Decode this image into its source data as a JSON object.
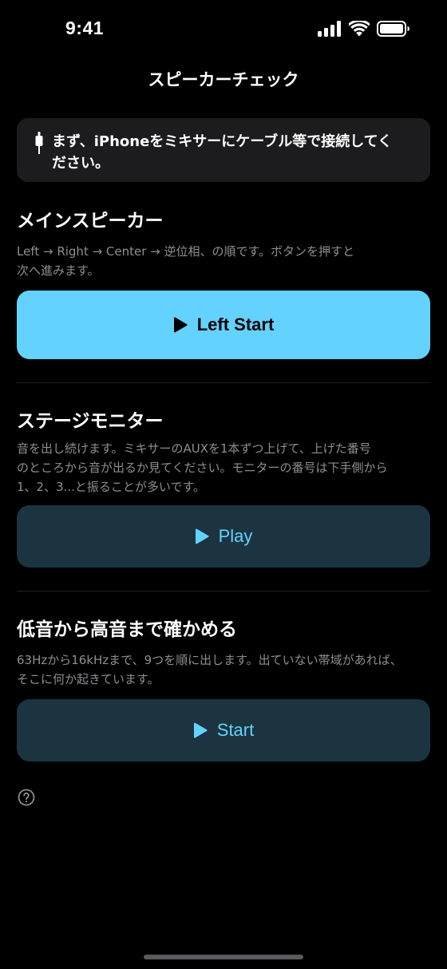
{
  "status_bar": {
    "time": "9:41"
  },
  "nav": {
    "title": "スピーカーチェック"
  },
  "info_banner": {
    "icon": "cable-icon",
    "text": "まず、iPhoneをミキサーにケーブル等で接続してください。"
  },
  "main_speaker": {
    "title": "メインスピーカー",
    "description_lines": [
      "Left → Right → Center → 逆位相、の順です。ボタンを押すと",
      "次へ進みます。"
    ],
    "button_label": "Left Start",
    "button_icon": "play-icon"
  },
  "stage_monitor": {
    "title": "ステージモニター",
    "description_lines": [
      "音を出し続けます。ミキサーのAUXを1本ずつ上げて、上げた番号",
      "のところから音が出るか見てください。モニターの番号は下手側から",
      "1、2、3...と振ることが多いです。"
    ],
    "button_label": "Play",
    "button_icon": "play-icon"
  },
  "frequency_sweep": {
    "title": "低音から高音まで確かめる",
    "description_lines": [
      "63Hzから16kHzまで、9つを順に出します。出ていない帯域があれば、",
      "そこに何か起きています。"
    ],
    "button_label": "Start",
    "button_icon": "play-icon"
  },
  "footer": {
    "help_icon": "question-circle-icon"
  },
  "colors": {
    "background": "#000000",
    "accent": "#64d2ff",
    "secondary_button": "#1b3440",
    "banner": "#1c1c1e",
    "muted_text": "#8e8e93"
  }
}
